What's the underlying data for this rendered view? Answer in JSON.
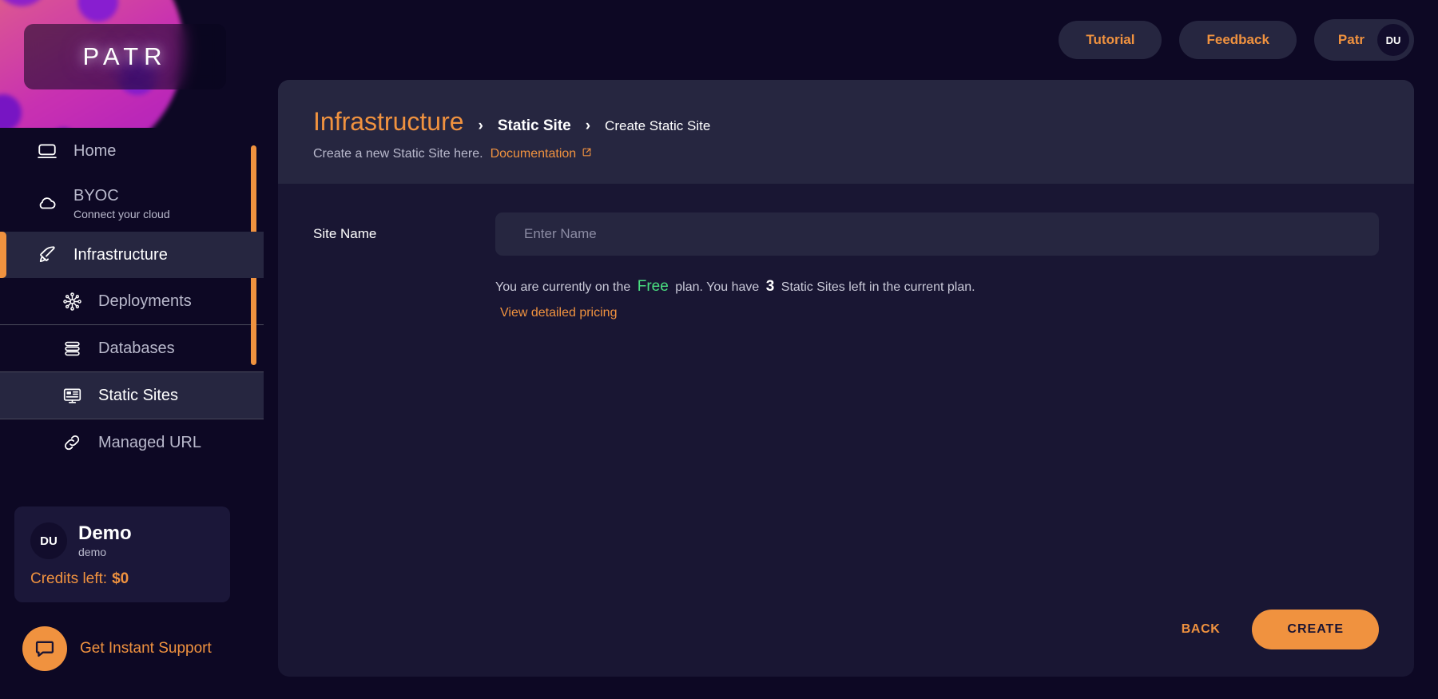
{
  "brand": {
    "logo_text": "PATR",
    "accent_color": "#f0923f",
    "page_bg": "#0d0824",
    "panel_bg": "#191633",
    "panel_header_bg": "#262640",
    "success_color": "#4ade80"
  },
  "sidebar": {
    "items": [
      {
        "label": "Home",
        "icon": "monitor-icon",
        "sublabel": null,
        "active": false,
        "sub": false
      },
      {
        "label": "BYOC",
        "icon": "cloud-icon",
        "sublabel": "Connect your cloud",
        "active": false,
        "sub": false
      },
      {
        "label": "Infrastructure",
        "icon": "rocket-icon",
        "sublabel": null,
        "active": true,
        "sub": false
      },
      {
        "label": "Deployments",
        "icon": "nodes-icon",
        "sublabel": null,
        "active": false,
        "sub": true
      },
      {
        "label": "Databases",
        "icon": "database-icon",
        "sublabel": null,
        "active": false,
        "sub": true
      },
      {
        "label": "Static Sites",
        "icon": "display-icon",
        "sublabel": null,
        "active": true,
        "sub": true
      },
      {
        "label": "Managed URL",
        "icon": "link-icon",
        "sublabel": null,
        "active": false,
        "sub": true
      }
    ],
    "workspace": {
      "avatar_initials": "DU",
      "name": "Demo",
      "slug": "demo",
      "credits_label": "Credits left:",
      "credits_value": "$0"
    },
    "support": {
      "label": "Get Instant Support",
      "icon": "chat-icon"
    }
  },
  "topbar": {
    "tutorial_label": "Tutorial",
    "feedback_label": "Feedback",
    "user_name": "Patr",
    "user_initials": "DU"
  },
  "panel": {
    "breadcrumb": {
      "primary": "Infrastructure",
      "separator": "›",
      "middle": "Static Site",
      "last": "Create Static Site"
    },
    "subtitle_text": "Create a new Static Site here.",
    "documentation_link": "Documentation",
    "form": {
      "site_name_label": "Site Name",
      "site_name_value": "",
      "site_name_placeholder": "Enter Name"
    },
    "plan_note": {
      "prefix": "You are currently on the",
      "plan_name": "Free",
      "middle": "plan. You have",
      "count": "3",
      "suffix": "Static Sites left in the current plan.",
      "pricing_link": "View detailed pricing"
    },
    "footer": {
      "back_label": "BACK",
      "create_label": "CREATE"
    }
  }
}
